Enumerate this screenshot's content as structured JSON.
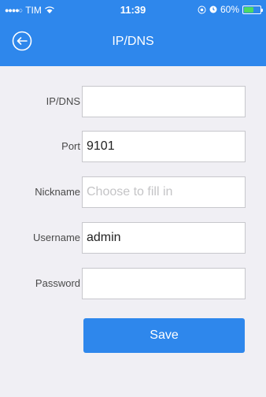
{
  "status_bar": {
    "carrier_dots": "●●●●○",
    "carrier": "TIM",
    "time": "11:39",
    "battery_percent": "60%",
    "battery_level": 0.6
  },
  "navbar": {
    "title": "IP/DNS",
    "back_icon": "back-circle-arrow-icon"
  },
  "form": {
    "fields": [
      {
        "label": "IP/DNS",
        "value": "",
        "placeholder": ""
      },
      {
        "label": "Port",
        "value": "9101",
        "placeholder": ""
      },
      {
        "label": "Nickname",
        "value": "",
        "placeholder": "Choose to fill in"
      },
      {
        "label": "Username",
        "value": "admin",
        "placeholder": ""
      },
      {
        "label": "Password",
        "value": "",
        "placeholder": ""
      }
    ],
    "save_label": "Save"
  },
  "colors": {
    "accent": "#2e87ec",
    "background": "#f0eff4",
    "battery": "#4cd964"
  }
}
